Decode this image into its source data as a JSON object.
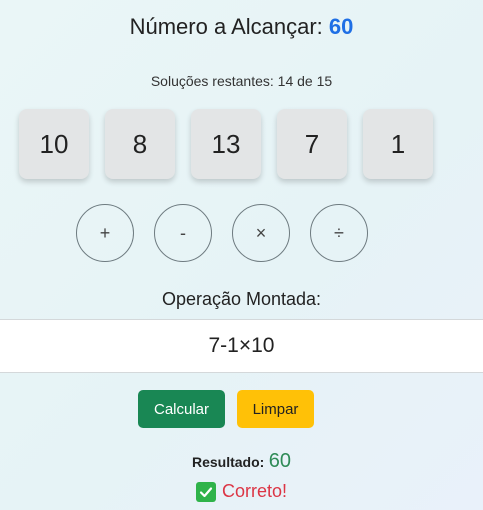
{
  "header": {
    "title_prefix": "Número a Alcançar:",
    "target_number": "60"
  },
  "remaining_solutions": "Soluções restantes: 14 de 15",
  "tiles": [
    "10",
    "8",
    "13",
    "7",
    "1"
  ],
  "operators": [
    {
      "symbol": "+",
      "name": "plus"
    },
    {
      "symbol": "-",
      "name": "minus"
    },
    {
      "symbol": "×",
      "name": "times"
    },
    {
      "symbol": "÷",
      "name": "divide"
    }
  ],
  "expression": {
    "label": "Operação Montada:",
    "value": "7-1×10"
  },
  "buttons": {
    "calculate": "Calcular",
    "clear": "Limpar"
  },
  "result": {
    "label": "Resultado:",
    "value": "60",
    "status": "Correto!",
    "status_icon": "check-icon"
  },
  "colors": {
    "target": "#1f6fe5",
    "calculate_button": "#198754",
    "clear_button": "#ffc107",
    "result_value": "#2e8b57",
    "status_text": "#dc3545",
    "check": "#2fb34a"
  }
}
